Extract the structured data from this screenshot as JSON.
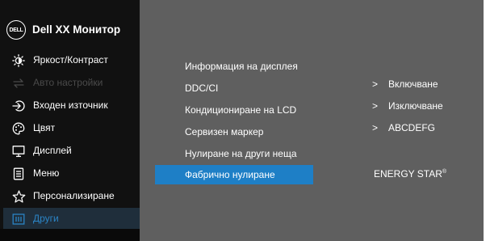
{
  "header": {
    "logo_text": "DELL",
    "title": "Dell XX Монитор"
  },
  "sidebar": {
    "items": [
      {
        "label": "Яркост/Контраст",
        "icon": "brightness-icon",
        "state": "enabled"
      },
      {
        "label": "Авто настройки",
        "icon": "auto-adjust-icon",
        "state": "disabled"
      },
      {
        "label": "Входен източник",
        "icon": "input-source-icon",
        "state": "enabled"
      },
      {
        "label": "Цвят",
        "icon": "color-palette-icon",
        "state": "enabled"
      },
      {
        "label": "Дисплей",
        "icon": "monitor-icon",
        "state": "enabled"
      },
      {
        "label": "Меню",
        "icon": "menu-document-icon",
        "state": "enabled"
      },
      {
        "label": "Персонализиране",
        "icon": "star-icon",
        "state": "enabled"
      },
      {
        "label": "Други",
        "icon": "others-icon",
        "state": "active"
      }
    ]
  },
  "submenu": {
    "items": [
      {
        "label": "Информация на дисплея"
      },
      {
        "label": "DDC/CI"
      },
      {
        "label": "Кондициониране на LCD"
      },
      {
        "label": "Сервизен маркер"
      },
      {
        "label": "Нулиране на други неща"
      },
      {
        "label": "Фабрично нулиране",
        "selected": true
      }
    ],
    "values": [
      {
        "arrow": ">",
        "text": "Включване"
      },
      {
        "arrow": ">",
        "text": "Изключване"
      },
      {
        "arrow": ">",
        "text": "ABCDEFG"
      }
    ],
    "energy_star": "ENERGY STAR",
    "energy_star_mark": "®"
  },
  "colors": {
    "sidebar_bg": "#111111",
    "panel_bg": "#5f5f5f",
    "accent": "#1e7fc6",
    "active_text": "#2b84c5",
    "disabled_text": "#4a4a4a"
  }
}
